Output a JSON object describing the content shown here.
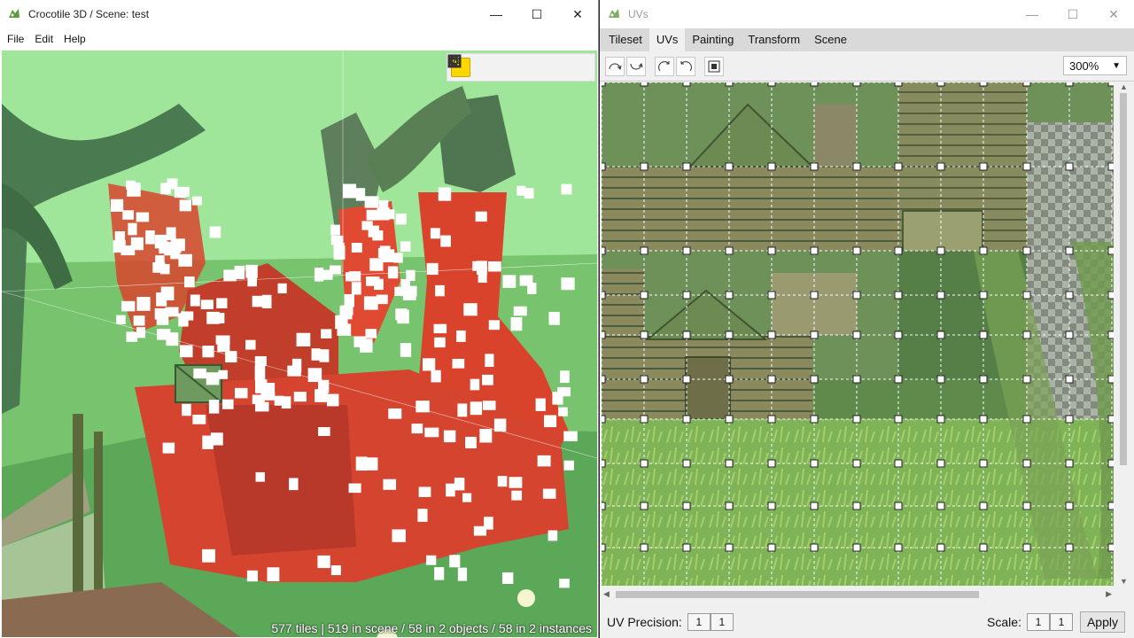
{
  "main_window": {
    "title": "Crocotile 3D / Scene: test",
    "controls": {
      "minimize": "—",
      "maximize": "☐",
      "close": "✕"
    },
    "menu": [
      "File",
      "Edit",
      "Help"
    ],
    "viewport": {
      "status": "577 tiles | 519 in scene / 58 in 2 objects / 58 in 2 instances",
      "tools": [
        "grid-tool",
        "cube-tool",
        "transform-tool",
        "select-box-tool",
        "rotate-left-tool",
        "rotate-right-tool"
      ]
    }
  },
  "uv_window": {
    "title": "UVs",
    "controls": {
      "minimize": "—",
      "maximize": "☐",
      "close": "✕"
    },
    "tabs": [
      "Tileset",
      "UVs",
      "Painting",
      "Transform",
      "Scene"
    ],
    "active_tab": "UVs",
    "zoom": "300%",
    "footer": {
      "precision_label": "UV Precision:",
      "precision_x": "1",
      "precision_y": "1",
      "scale_label": "Scale:",
      "scale_x": "1",
      "scale_y": "1",
      "apply": "Apply"
    }
  },
  "colors": {
    "sky": "#9fe59a",
    "selection": "#e03a2a",
    "active_tool": "#ffd700"
  }
}
